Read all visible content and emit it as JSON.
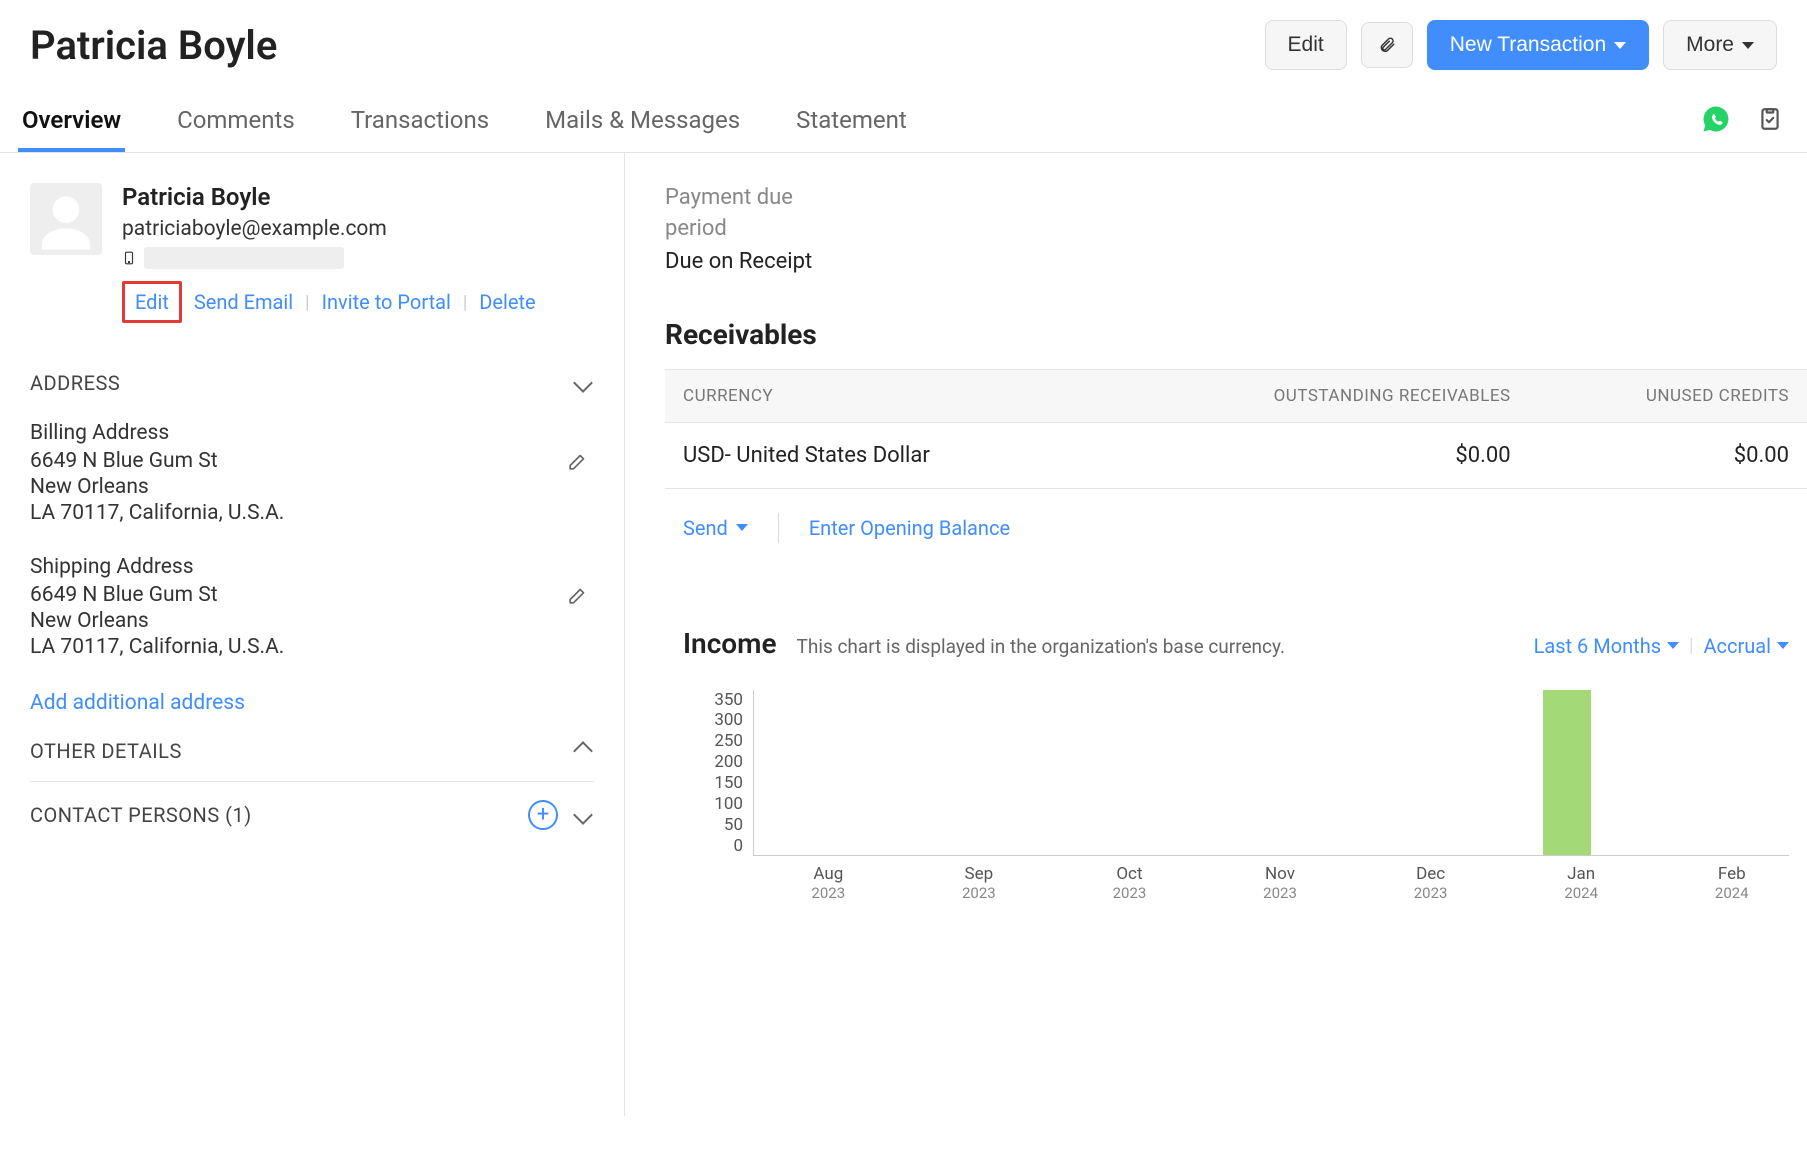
{
  "header": {
    "title": "Patricia Boyle",
    "edit": "Edit",
    "new_transaction": "New Transaction",
    "more": "More"
  },
  "tabs": {
    "overview": "Overview",
    "comments": "Comments",
    "transactions": "Transactions",
    "mails": "Mails & Messages",
    "statement": "Statement"
  },
  "contact": {
    "name": "Patricia Boyle",
    "email": "patriciaboyle@example.com",
    "actions": {
      "edit": "Edit",
      "send_email": "Send Email",
      "invite": "Invite to Portal",
      "delete": "Delete"
    }
  },
  "sections": {
    "address_title": "ADDRESS",
    "other_details_title": "OTHER DETAILS",
    "contact_persons_title": "CONTACT PERSONS (1)",
    "add_additional": "Add additional address"
  },
  "billing": {
    "label": "Billing Address",
    "line1": "6649 N Blue Gum St",
    "line2": "New Orleans",
    "line3": "LA 70117, California, U.S.A."
  },
  "shipping": {
    "label": "Shipping Address",
    "line1": "6649 N Blue Gum St",
    "line2": "New Orleans",
    "line3": "LA 70117, California, U.S.A."
  },
  "payment": {
    "label": "Payment due period",
    "value": "Due on Receipt"
  },
  "receivables": {
    "heading": "Receivables",
    "th_currency": "CURRENCY",
    "th_outstanding": "OUTSTANDING RECEIVABLES",
    "th_unused": "UNUSED CREDITS",
    "row_currency": "USD- United States Dollar",
    "row_outstanding": "$0.00",
    "row_unused": "$0.00",
    "send": "Send",
    "enter_opening": "Enter Opening Balance"
  },
  "income": {
    "title": "Income",
    "note": "This chart is displayed in the organization's base currency.",
    "range": "Last 6 Months",
    "basis": "Accrual"
  },
  "chart_data": {
    "type": "bar",
    "categories": [
      "Aug 2023",
      "Sep 2023",
      "Oct 2023",
      "Nov 2023",
      "Dec 2023",
      "Jan 2024",
      "Feb 2024"
    ],
    "values": [
      0,
      0,
      0,
      0,
      0,
      365,
      0
    ],
    "title": "Income",
    "xlabel": "",
    "ylabel": "",
    "ylim": [
      0,
      350
    ],
    "y_ticks": [
      350,
      300,
      250,
      200,
      150,
      100,
      50,
      0
    ]
  }
}
